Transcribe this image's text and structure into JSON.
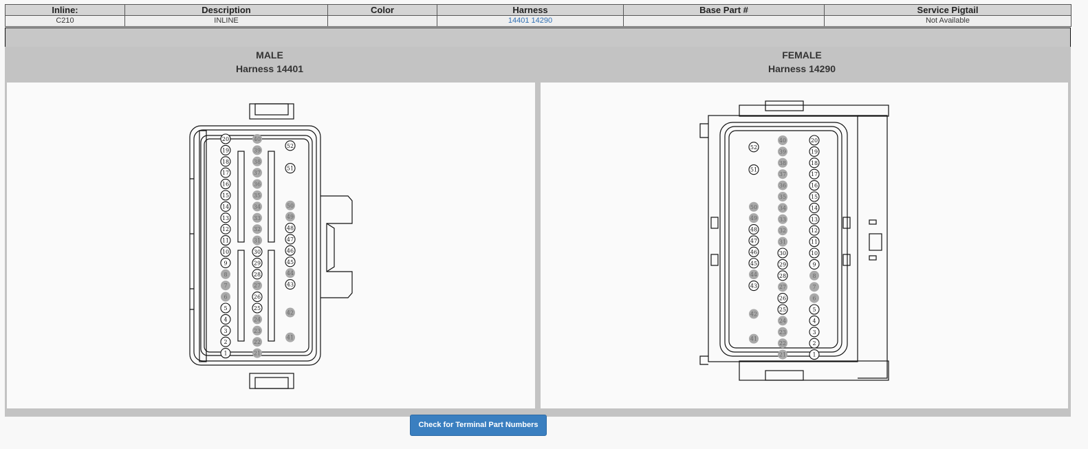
{
  "table": {
    "headers": [
      "Inline:",
      "Description",
      "Color",
      "Harness",
      "Base Part #",
      "Service Pigtail"
    ],
    "row": {
      "inline": "C210",
      "description": "INLINE",
      "color": "",
      "harness": "14401 14290",
      "base_part": "",
      "service_pigtail": "Not Available"
    }
  },
  "male": {
    "title": "MALE",
    "harness": "Harness 14401"
  },
  "female": {
    "title": "FEMALE",
    "harness": "Harness 14290"
  },
  "button": {
    "label": "Check for Terminal Part Numbers"
  },
  "pins": {
    "male": {
      "col1": [
        "20",
        "19",
        "18",
        "17",
        "16",
        "15",
        "14",
        "13",
        "12",
        "11",
        "10",
        "9",
        "8",
        "7",
        "6",
        "5",
        "4",
        "3",
        "2",
        "1"
      ],
      "col2": [
        "40",
        "39",
        "38",
        "37",
        "36",
        "35",
        "34",
        "33",
        "32",
        "31",
        "30",
        "29",
        "28",
        "27",
        "26",
        "25",
        "24",
        "23",
        "22",
        "21"
      ],
      "col3": [
        "52",
        "51",
        "50",
        "49",
        "48",
        "47",
        "46",
        "45",
        "44",
        "43",
        "42",
        "41"
      ],
      "filled": [
        "8",
        "7",
        "6",
        "40",
        "39",
        "38",
        "37",
        "36",
        "35",
        "34",
        "33",
        "32",
        "31",
        "27",
        "24",
        "23",
        "22",
        "21",
        "50",
        "49",
        "44",
        "42",
        "41"
      ]
    },
    "female": {
      "col1": [
        "52",
        "51",
        "50",
        "49",
        "48",
        "47",
        "46",
        "45",
        "44",
        "43",
        "42",
        "41"
      ],
      "col2": [
        "40",
        "39",
        "38",
        "37",
        "36",
        "35",
        "34",
        "33",
        "32",
        "31",
        "30",
        "29",
        "28",
        "27",
        "26",
        "25",
        "24",
        "23",
        "22",
        "21"
      ],
      "col3": [
        "20",
        "19",
        "18",
        "17",
        "16",
        "15",
        "14",
        "13",
        "12",
        "11",
        "10",
        "9",
        "8",
        "7",
        "6",
        "5",
        "4",
        "3",
        "2",
        "1"
      ],
      "filled": [
        "8",
        "7",
        "6",
        "40",
        "39",
        "38",
        "37",
        "36",
        "35",
        "34",
        "33",
        "32",
        "31",
        "27",
        "24",
        "23",
        "22",
        "21",
        "50",
        "49",
        "44",
        "42",
        "41"
      ]
    }
  },
  "colors": {
    "link": "#2f6fb3",
    "button": "#3a7fc0",
    "filled_pin": "#a9a9a9"
  }
}
